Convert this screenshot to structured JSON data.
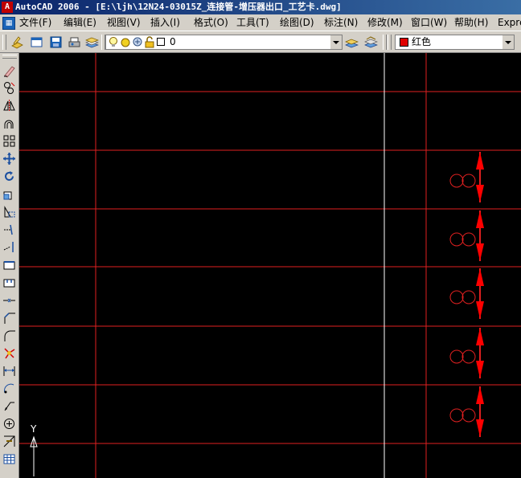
{
  "window": {
    "title": "AutoCAD 2006 - [E:\\ljh\\12N24-03015Z_连接管-增压器出口_工艺卡.dwg]"
  },
  "menu": {
    "items": [
      {
        "label": "文件(F)"
      },
      {
        "label": "编辑(E)"
      },
      {
        "label": "视图(V)"
      },
      {
        "label": "插入(I)"
      },
      {
        "label": "格式(O)"
      },
      {
        "label": "工具(T)"
      },
      {
        "label": "绘图(D)"
      },
      {
        "label": "标注(N)"
      },
      {
        "label": "修改(M)"
      },
      {
        "label": "窗口(W)"
      },
      {
        "label": "帮助(H)"
      },
      {
        "label": "Expre"
      }
    ]
  },
  "toolbar": {
    "layer_value": "0",
    "color_value": "红色",
    "color_swatch": "#e00000"
  },
  "canvas": {
    "background": "#000000",
    "grid_color": "#e02020",
    "cursor_color": "#ffffff",
    "ucs_y_label": "Y",
    "symbol_count": 5
  },
  "icons": {
    "top_toolbar": [
      "make-object-layer-icon",
      "new-icon",
      "save-icon",
      "plot-icon",
      "layer-states-icon",
      "lightbulb-icon",
      "sun-icon",
      "freeze-icon",
      "lock-icon",
      "color-square-icon",
      "layer-previous-icon",
      "layer-manager-icon"
    ],
    "left_toolbar": [
      "erase-icon",
      "copy-icon",
      "mirror-icon",
      "offset-icon",
      "array-icon",
      "move-icon",
      "rotate-icon",
      "scale-icon",
      "stretch-icon",
      "trim-icon",
      "extend-icon",
      "break-at-point-icon",
      "break-icon",
      "join-icon",
      "chamfer-icon",
      "fillet-icon",
      "explode-icon",
      "dimension-icon",
      "arc-dimension-icon",
      "leader-icon",
      "center-mark-icon",
      "tolerance-icon",
      "table-icon"
    ]
  }
}
